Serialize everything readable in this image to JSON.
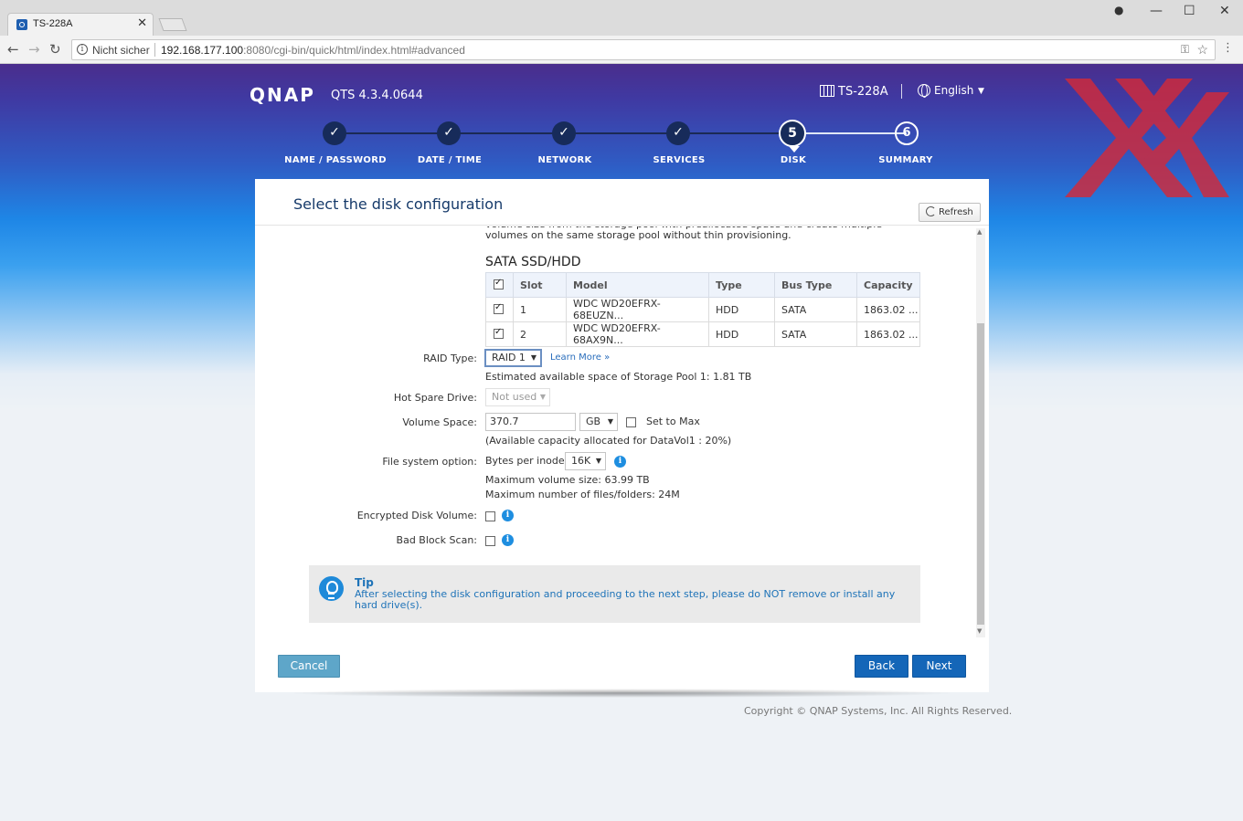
{
  "browser": {
    "tab_title": "TS-228A",
    "tab_close": "✕",
    "security_label": "Nicht sicher",
    "url_host": "192.168.177.100",
    "url_port": ":8080",
    "url_path": "/cgi-bin/quick/html/index.html#advanced"
  },
  "header": {
    "logo": "QNAP",
    "version": "QTS 4.3.4.0644",
    "device_name": "TS-228A",
    "language": "English"
  },
  "stepper": {
    "steps": [
      {
        "label": "NAME / PASSWORD",
        "marker": "✓",
        "state": "done"
      },
      {
        "label": "DATE / TIME",
        "marker": "✓",
        "state": "done"
      },
      {
        "label": "NETWORK",
        "marker": "✓",
        "state": "done"
      },
      {
        "label": "SERVICES",
        "marker": "✓",
        "state": "done"
      },
      {
        "label": "DISK",
        "marker": "5",
        "state": "current"
      },
      {
        "label": "SUMMARY",
        "marker": "6",
        "state": "future"
      }
    ]
  },
  "panel": {
    "title": "Select the disk configuration",
    "refresh_label": "Refresh",
    "intro_text": "volume size from the storage pool with preallocated space and create multiple volumes on the same storage pool without thin provisioning.",
    "disk_section_title": "SATA SSD/HDD",
    "table": {
      "columns": [
        "Slot",
        "Model",
        "Type",
        "Bus Type",
        "Capacity"
      ],
      "rows": [
        {
          "slot": "1",
          "model": "WDC WD20EFRX-68EUZN...",
          "type": "HDD",
          "bus": "SATA",
          "capacity": "1863.02 ...",
          "checked": true
        },
        {
          "slot": "2",
          "model": "WDC WD20EFRX-68AX9N...",
          "type": "HDD",
          "bus": "SATA",
          "capacity": "1863.02 ...",
          "checked": true
        }
      ]
    },
    "raid": {
      "label": "RAID Type:",
      "value": "RAID 1",
      "learn_more": "Learn More »",
      "estimate": "Estimated available space of Storage Pool 1: 1.81 TB"
    },
    "hot_spare": {
      "label": "Hot Spare Drive:",
      "value": "Not used"
    },
    "volume": {
      "label": "Volume Space:",
      "value": "370.7",
      "unit": "GB",
      "set_to_max": "Set to Max",
      "note": "(Available capacity allocated for DataVol1 : 20%)"
    },
    "filesystem": {
      "label": "File system option:",
      "bytes_label": "Bytes per inode:",
      "bytes_value": "16K",
      "max_volume": "Maximum volume size: 63.99 TB",
      "max_files": "Maximum number of files/folders: 24M"
    },
    "encrypted": {
      "label": "Encrypted Disk Volume:"
    },
    "bad_block": {
      "label": "Bad Block Scan:"
    },
    "tip": {
      "title": "Tip",
      "text": "After selecting the disk configuration and proceeding to the next step, please do NOT remove or install any hard drive(s)."
    },
    "buttons": {
      "cancel": "Cancel",
      "back": "Back",
      "next": "Next"
    }
  },
  "footer": {
    "copyright": "Copyright © QNAP Systems, Inc. All Rights Reserved."
  },
  "colors": {
    "primary_button": "#1466b8",
    "cancel_button": "#5ea6c9",
    "title_text": "#163a6a",
    "info_icon": "#1e8ee0",
    "watermark": "#d22a3a"
  }
}
